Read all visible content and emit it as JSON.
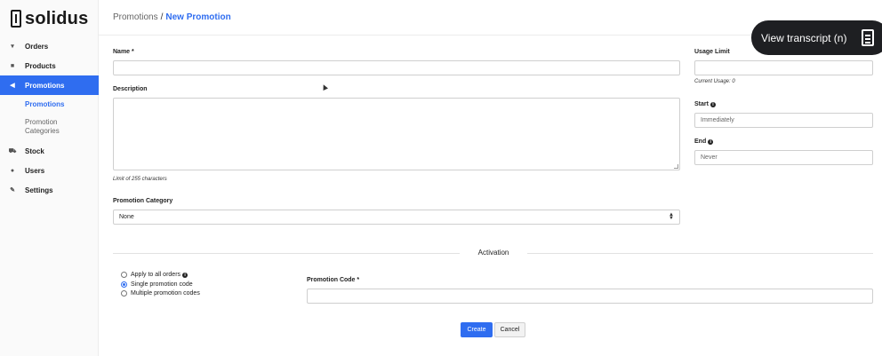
{
  "app": {
    "logo_text": "solidus"
  },
  "sidebar": {
    "items": [
      {
        "label": "Orders",
        "icon": "cart-icon"
      },
      {
        "label": "Products",
        "icon": "grid-icon"
      },
      {
        "label": "Promotions",
        "icon": "megaphone-icon"
      },
      {
        "label": "Stock",
        "icon": "truck-icon"
      },
      {
        "label": "Users",
        "icon": "user-icon"
      },
      {
        "label": "Settings",
        "icon": "wrench-icon"
      }
    ],
    "sub_items": [
      {
        "label": "Promotions"
      },
      {
        "label": "Promotion Categories"
      }
    ]
  },
  "breadcrumb": {
    "parent": "Promotions",
    "separator": "/",
    "current": "New Promotion"
  },
  "overlay": {
    "view_transcript": "View transcript (n)"
  },
  "form": {
    "name_label": "Name *",
    "name_value": "",
    "description_label": "Description",
    "description_hint": "Limit of 255 characters",
    "category_label": "Promotion Category",
    "category_selected": "None",
    "usage_limit_label": "Usage Limit",
    "current_usage_hint": "Current Usage: 0",
    "start_label": "Start",
    "start_placeholder": "Immediately",
    "end_label": "End",
    "end_placeholder": "Never",
    "activation_title": "Activation",
    "apply_options": [
      {
        "label": "Apply to all orders",
        "checked": false
      },
      {
        "label": "Single promotion code",
        "checked": true
      },
      {
        "label": "Multiple promotion codes",
        "checked": false
      }
    ],
    "promotion_code_label": "Promotion Code *",
    "create_label": "Create",
    "cancel_label": "Cancel"
  },
  "colors": {
    "accent": "#2f6df0",
    "overlay_bg": "#1e1f22"
  }
}
